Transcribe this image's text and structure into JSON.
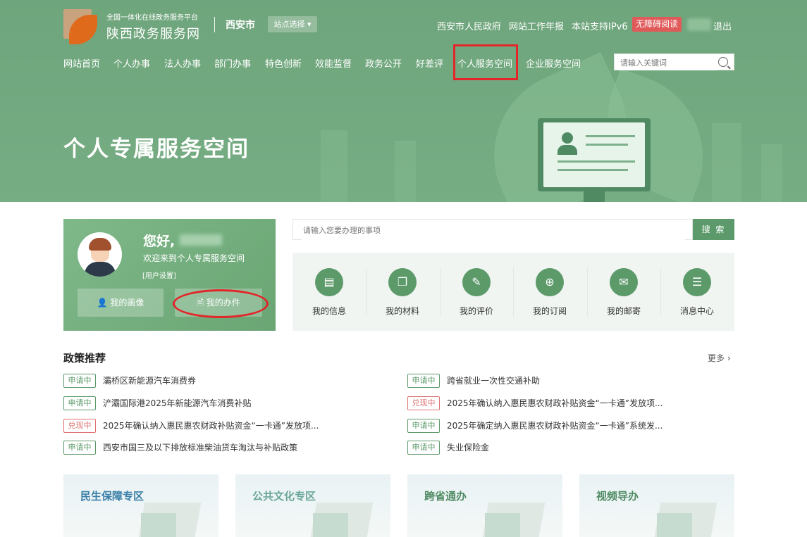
{
  "header": {
    "site_subtitle": "全国一体化在线政务服务平台",
    "site_title": "陕西政务服务网",
    "city": "西安市",
    "site_select": "站点选择",
    "links": [
      "西安市人民政府",
      "网站工作年报",
      "本站支持IPv6"
    ],
    "accessibility": "无障碍阅读",
    "logout": "退出",
    "search_placeholder": "请输入关键词"
  },
  "nav": {
    "items": [
      "网站首页",
      "个人办事",
      "法人办事",
      "部门办事",
      "特色创新",
      "效能监督",
      "政务公开",
      "好差评",
      "个人服务空间",
      "企业服务空间"
    ]
  },
  "hero": {
    "title": "个人专属服务空间"
  },
  "profile": {
    "greeting": "您好,",
    "welcome": "欢迎来到个人专属服务空间",
    "settings": "[用户设置]",
    "btn_portrait": "我的画像",
    "btn_affairs": "我的办件"
  },
  "search": {
    "placeholder": "请输入您要办理的事项",
    "button": "搜 索"
  },
  "quick": [
    {
      "label": "我的信息",
      "icon": "document-icon"
    },
    {
      "label": "我的材料",
      "icon": "files-icon"
    },
    {
      "label": "我的评价",
      "icon": "edit-icon"
    },
    {
      "label": "我的订阅",
      "icon": "add-file-icon"
    },
    {
      "label": "我的邮寄",
      "icon": "mail-icon"
    },
    {
      "label": "消息中心",
      "icon": "message-icon"
    }
  ],
  "policy": {
    "title": "政策推荐",
    "more": "更多 ›",
    "left": [
      {
        "status": "申请中",
        "text": "灞桥区新能源汽车消费券"
      },
      {
        "status": "申请中",
        "text": "浐灞国际港2025年新能源汽车消费补贴"
      },
      {
        "status": "兑现中",
        "text": "2025年确认纳入惠民惠农财政补贴资金“一卡通”发放项..."
      },
      {
        "status": "申请中",
        "text": "西安市国三及以下排放标准柴油货车淘汰与补贴政策"
      }
    ],
    "right": [
      {
        "status": "申请中",
        "text": "跨省就业一次性交通补助"
      },
      {
        "status": "兑现中",
        "text": "2025年确认纳入惠民惠农财政补贴资金“一卡通”发放项..."
      },
      {
        "status": "申请中",
        "text": "2025年确定纳入惠民惠农财政补贴资金“一卡通”系统发..."
      },
      {
        "status": "申请中",
        "text": "失业保险金"
      }
    ]
  },
  "cards": [
    {
      "title": "民生保障专区",
      "color": "#3a7fa8"
    },
    {
      "title": "公共文化专区",
      "color": "#6aa69a"
    },
    {
      "title": "跨省通办",
      "color": "#4f8a63"
    },
    {
      "title": "视频导办",
      "color": "#4f8a63"
    }
  ]
}
